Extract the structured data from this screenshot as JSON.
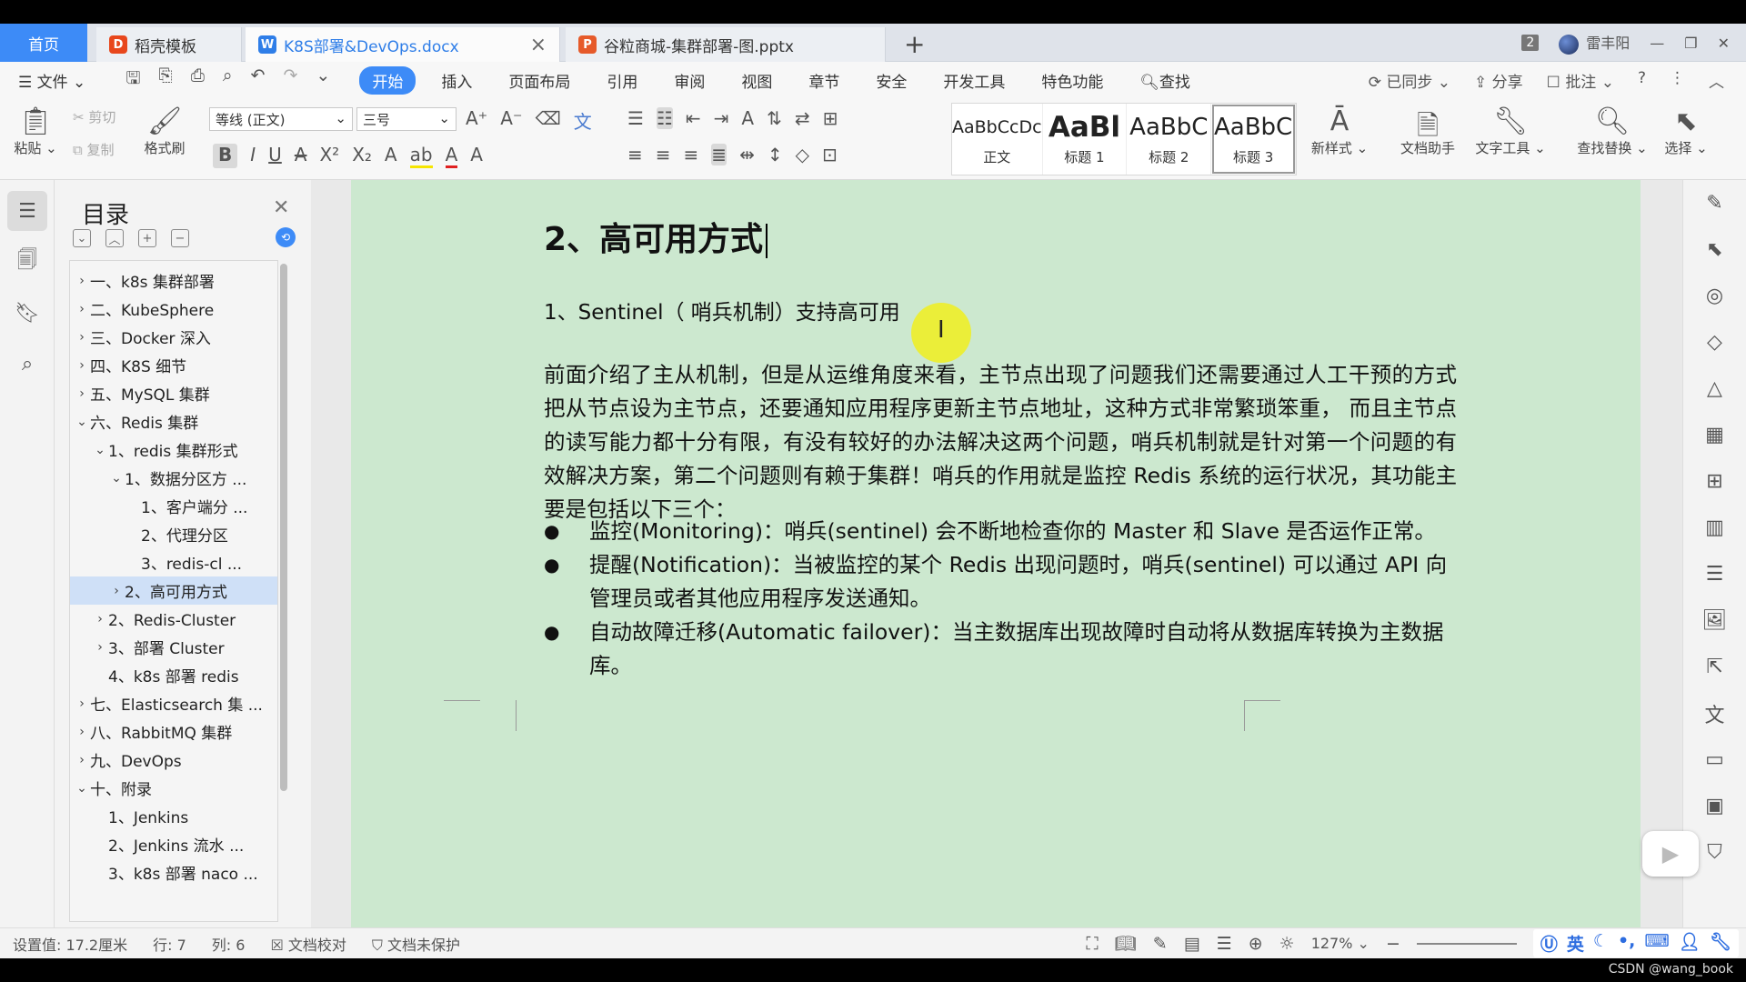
{
  "tabs": {
    "home": "首页",
    "template": "稻壳模板",
    "doc": "K8S部署&DevOps.docx",
    "ppt": "谷粒商城-集群部署-图.pptx",
    "new_tab": "+",
    "window_count": "2",
    "user": "雷丰阳"
  },
  "menu": {
    "file": "文件",
    "items": [
      "开始",
      "插入",
      "页面布局",
      "引用",
      "审阅",
      "视图",
      "章节",
      "安全",
      "开发工具",
      "特色功能"
    ],
    "search": "查找",
    "synced": "已同步",
    "share": "分享",
    "comment": "批注"
  },
  "ribbon": {
    "paste": "粘贴",
    "cut": "剪切",
    "copy": "复制",
    "format_painter": "格式刷",
    "font": "等线 (正文)",
    "size": "三号",
    "styles": [
      {
        "sample": "AaBbCcDc",
        "name": "正文"
      },
      {
        "sample": "AaBl",
        "name": "标题 1"
      },
      {
        "sample": "AaBbC",
        "name": "标题 2"
      },
      {
        "sample": "AaBbC",
        "name": "标题 3"
      }
    ],
    "new_style": "新样式",
    "doc_assistant": "文档助手",
    "text_tools": "文字工具",
    "find_replace": "查找替换",
    "select": "选择"
  },
  "toc": {
    "title": "目录",
    "items": [
      {
        "label": "一、k8s 集群部署",
        "level": 0,
        "arrow": "›"
      },
      {
        "label": "二、KubeSphere",
        "level": 0,
        "arrow": "›"
      },
      {
        "label": "三、Docker 深入",
        "level": 0,
        "arrow": "›"
      },
      {
        "label": "四、K8S 细节",
        "level": 0,
        "arrow": "›"
      },
      {
        "label": "五、MySQL 集群",
        "level": 0,
        "arrow": "›"
      },
      {
        "label": "六、Redis 集群",
        "level": 0,
        "arrow": "⌄"
      },
      {
        "label": "1、redis 集群形式",
        "level": 1,
        "arrow": "⌄"
      },
      {
        "label": "1、数据分区方 ...",
        "level": 2,
        "arrow": "⌄"
      },
      {
        "label": "1、客户端分 ...",
        "level": 3,
        "arrow": ""
      },
      {
        "label": "2、代理分区",
        "level": 3,
        "arrow": ""
      },
      {
        "label": "3、redis-cl ...",
        "level": 3,
        "arrow": ""
      },
      {
        "label": "2、高可用方式",
        "level": 2,
        "arrow": "›",
        "selected": true
      },
      {
        "label": "2、Redis-Cluster",
        "level": 1,
        "arrow": "›"
      },
      {
        "label": "3、部署 Cluster",
        "level": 1,
        "arrow": "›"
      },
      {
        "label": "4、k8s 部署 redis",
        "level": 1,
        "arrow": ""
      },
      {
        "label": "七、Elasticsearch 集 ...",
        "level": 0,
        "arrow": "›"
      },
      {
        "label": "八、RabbitMQ 集群",
        "level": 0,
        "arrow": "›"
      },
      {
        "label": "九、DevOps",
        "level": 0,
        "arrow": "›"
      },
      {
        "label": "十、附录",
        "level": 0,
        "arrow": "⌄"
      },
      {
        "label": "1、Jenkins",
        "level": 1,
        "arrow": ""
      },
      {
        "label": "2、Jenkins 流水 ...",
        "level": 1,
        "arrow": ""
      },
      {
        "label": "3、k8s 部署 naco ...",
        "level": 1,
        "arrow": ""
      }
    ]
  },
  "document": {
    "heading": "2、高可用方式",
    "subheading": "1、Sentinel（ 哨兵机制）支持高可用",
    "paragraph": "前面介绍了主从机制，但是从运维角度来看，主节点出现了问题我们还需要通过人工干预的方式把从节点设为主节点，还要通知应用程序更新主节点地址，这种方式非常繁琐笨重， 而且主节点的读写能力都十分有限，有没有较好的办法解决这两个问题，哨兵机制就是针对第一个问题的有效解决方案，第二个问题则有赖于集群！哨兵的作用就是监控 Redis 系统的运行状况，其功能主要是包括以下三个：",
    "bullets": [
      "监控(Monitoring)：哨兵(sentinel) 会不断地检查你的 Master 和 Slave 是否运作正常。",
      "提醒(Notification)：当被监控的某个 Redis 出现问题时，哨兵(sentinel) 可以通过 API 向管理员或者其他应用程序发送通知。",
      "自动故障迁移(Automatic failover)：当主数据库出现故障时自动将从数据库转换为主数据库。"
    ]
  },
  "status": {
    "setting": "设置值: 17.2厘米",
    "row": "行: 7",
    "col": "列: 6",
    "proofread": "文档校对",
    "protect": "文档未保护",
    "zoom": "127%",
    "ime": "英",
    "watermark": "CSDN @wang_book"
  },
  "colors": {
    "accent": "#3d8bf7",
    "page_bg": "#cce8cf",
    "cursor_highlight": "#f0ee1e"
  }
}
